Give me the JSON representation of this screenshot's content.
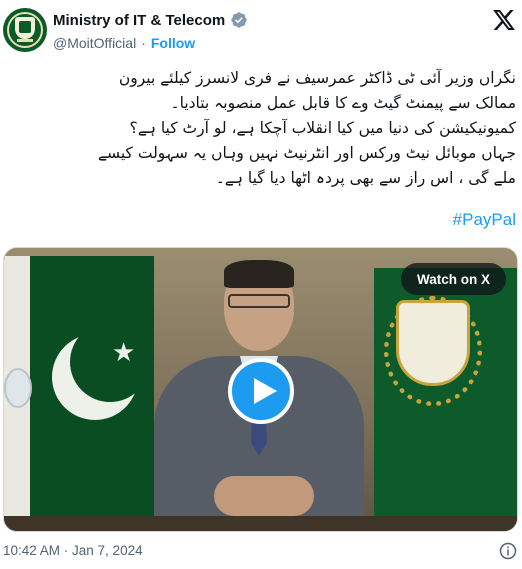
{
  "account": {
    "display_name": "Ministry of IT & Telecom",
    "handle": "@MoitOfficial",
    "separator": "·",
    "follow_label": "Follow",
    "verified_icon": "verified-badge-icon",
    "avatar": "ministry-emblem-avatar"
  },
  "tweet": {
    "text": "نگراں وزیر آئی ٹی ڈاکٹر عمرسیف نے فری لانسرز کیلئے بیرون\nممالک سے  پیمنٹ گیٹ وے کا قابل عمل منصوبہ بتادیا۔\nکمیونیکیشن  کی دنیا میں کیا انقلاب آچکا ہے، لو آرٹ کیا ہے؟\nجہاں موبائل نیٹ ورکس اور انٹرنیٹ نہیں وہاں یہ سہولت کیسے\nملے گی ، اس راز سے بھی پردہ اٹھا دیا گیا ہے۔",
    "hashtag": "#PayPal"
  },
  "media": {
    "watch_label": "Watch on X",
    "play_icon": "play-icon",
    "accent": "#1d9bf0"
  },
  "footer": {
    "timestamp": "10:42 AM · Jan 7, 2024",
    "info_icon": "info-icon"
  },
  "colors": {
    "text": "#0f1419",
    "secondary": "#536471",
    "link": "#1d9bf0"
  }
}
